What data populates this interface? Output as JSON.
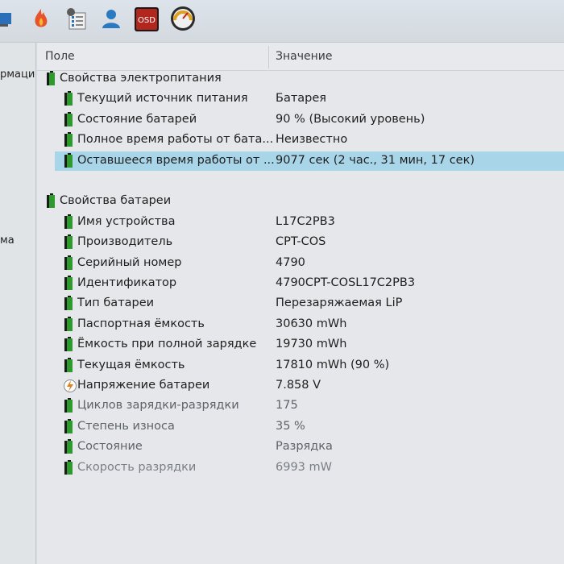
{
  "toolbar": {
    "icons": [
      "computer-icon",
      "flame-icon",
      "device-manager-icon",
      "user-icon",
      "osd-icon",
      "gauge-icon"
    ],
    "osd_label": "OSD"
  },
  "left_pane": {
    "items": [
      "рмаци",
      "ма"
    ]
  },
  "table": {
    "columns": {
      "field": "Поле",
      "value": "Значение"
    },
    "rows": [
      {
        "type": "section",
        "name": "Свойства электропитания",
        "value": "",
        "icon": "battery-icon"
      },
      {
        "type": "item",
        "name": "Текущий источник питания",
        "value": "Батарея",
        "icon": "battery-icon"
      },
      {
        "type": "item",
        "name": "Состояние батарей",
        "value": "90 % (Высокий уровень)",
        "icon": "battery-icon"
      },
      {
        "type": "item",
        "name": "Полное время работы от бата...",
        "value": "Неизвестно",
        "icon": "battery-icon"
      },
      {
        "type": "item",
        "name": "Оставшееся время работы от ...",
        "value": "9077 сек (2 час., 31 мин, 17 сек)",
        "icon": "battery-icon",
        "selected": true
      },
      {
        "type": "blank"
      },
      {
        "type": "section",
        "name": "Свойства батареи",
        "value": "",
        "icon": "battery-icon"
      },
      {
        "type": "item",
        "name": "Имя устройства",
        "value": "L17C2PB3",
        "icon": "battery-icon"
      },
      {
        "type": "item",
        "name": "Производитель",
        "value": "CPT-COS",
        "icon": "battery-icon"
      },
      {
        "type": "item",
        "name": "Серийный номер",
        "value": "4790",
        "icon": "battery-icon"
      },
      {
        "type": "item",
        "name": "Идентификатор",
        "value": "4790CPT-COSL17C2PB3",
        "icon": "battery-icon"
      },
      {
        "type": "item",
        "name": "Тип батареи",
        "value": "Перезаряжаемая LiP",
        "icon": "battery-icon"
      },
      {
        "type": "item",
        "name": "Паспортная ёмкость",
        "value": "30630 mWh",
        "icon": "battery-icon"
      },
      {
        "type": "item",
        "name": "Ёмкость при полной зарядке",
        "value": "19730 mWh",
        "icon": "battery-icon"
      },
      {
        "type": "item",
        "name": "Текущая ёмкость",
        "value": "17810 mWh  (90 %)",
        "icon": "battery-icon"
      },
      {
        "type": "item",
        "name": "Напряжение батареи",
        "value": "7.858 V",
        "icon": "voltage-icon"
      },
      {
        "type": "item",
        "name": "Циклов зарядки-разрядки",
        "value": "175",
        "icon": "battery-icon"
      },
      {
        "type": "item",
        "name": "Степень износа",
        "value": "35 %",
        "icon": "battery-icon"
      },
      {
        "type": "item",
        "name": "Состояние",
        "value": "Разрядка",
        "icon": "battery-icon"
      },
      {
        "type": "item",
        "name": "Скорость разрядки",
        "value": "6993 mW",
        "icon": "battery-icon"
      }
    ]
  },
  "colors": {
    "selection": "#a9d5e9",
    "battery_green": "#2e9a2e"
  }
}
